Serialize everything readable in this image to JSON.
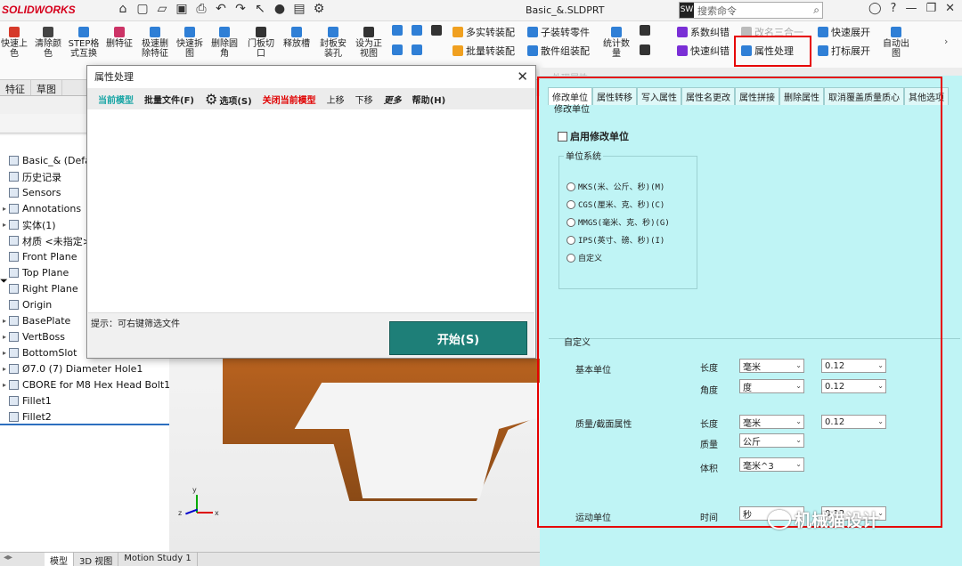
{
  "app": {
    "logo": "SOLIDWORKS",
    "doc_title": "Basic_&.SLDPRT",
    "search_placeholder": "搜索命令"
  },
  "ribbon": {
    "big_buttons": [
      {
        "label": "快速上\n色",
        "color": "#d63a2a"
      },
      {
        "label": "清除颜\n色",
        "color": "#444444"
      },
      {
        "label": "STEP格\n式互换",
        "color": "#2f7fd6"
      },
      {
        "label": "删特征",
        "color": "#cc3366"
      },
      {
        "label": "极速删\n除特征",
        "color": "#2f7fd6"
      },
      {
        "label": "快速拆\n图",
        "color": "#2f7fd6"
      },
      {
        "label": "删除圆\n角",
        "color": "#2f7fd6"
      },
      {
        "label": "门板切\n口",
        "color": "#333333"
      },
      {
        "label": "释放槽",
        "color": "#2f7fd6"
      },
      {
        "label": "封板安\n装孔",
        "color": "#2f7fd6"
      },
      {
        "label": "设为正\n视图",
        "color": "#333333"
      }
    ],
    "small_buttons": [
      {
        "label": "多实转装配",
        "color": "#f0a020"
      },
      {
        "label": "子装转零件",
        "color": "#2f7fd6"
      },
      {
        "label": "批量转装配",
        "color": "#f0a020"
      },
      {
        "label": "散件组装配",
        "color": "#2f7fd6"
      },
      {
        "label": "统计数\n量",
        "color": "#2f7fd6"
      },
      {
        "label": "系数纠错",
        "color": "#7a2fd6"
      },
      {
        "label": "改名三合一",
        "color": "#bbbbbb"
      },
      {
        "label": "快速展开",
        "color": "#2f7fd6"
      },
      {
        "label": "快速纠错",
        "color": "#7a2fd6"
      },
      {
        "label": "属性处理",
        "color": "#2f7fd6"
      },
      {
        "label": "打标展开",
        "color": "#2f7fd6"
      },
      {
        "label": "自动出\n图",
        "color": "#2f7fd6"
      }
    ]
  },
  "left_tabs": [
    "特征",
    "草图"
  ],
  "tree": [
    {
      "label": "Basic_& (Default)",
      "exp": ""
    },
    {
      "label": "历史记录",
      "exp": ""
    },
    {
      "label": "Sensors",
      "exp": ""
    },
    {
      "label": "Annotations",
      "exp": "▸"
    },
    {
      "label": "实体(1)",
      "exp": "▸"
    },
    {
      "label": "材质 <未指定>",
      "exp": ""
    },
    {
      "label": "Front Plane",
      "exp": ""
    },
    {
      "label": "Top Plane",
      "exp": ""
    },
    {
      "label": "Right Plane",
      "exp": ""
    },
    {
      "label": "Origin",
      "exp": ""
    },
    {
      "label": "BasePlate",
      "exp": "▸"
    },
    {
      "label": "VertBoss",
      "exp": "▸"
    },
    {
      "label": "BottomSlot",
      "exp": "▸"
    },
    {
      "label": "Ø7.0 (7) Diameter Hole1",
      "exp": "▸"
    },
    {
      "label": "CBORE for M8 Hex Head Bolt1",
      "exp": "▸"
    },
    {
      "label": "Fillet1",
      "exp": ""
    },
    {
      "label": "Fillet2",
      "exp": ""
    }
  ],
  "bottom_tabs": [
    "模型",
    "3D 视图",
    "Motion Study 1"
  ],
  "axes": {
    "x": "x",
    "y": "y",
    "z": "z"
  },
  "dialog": {
    "title": "属性处理",
    "menu": {
      "current_model": "当前模型",
      "batch_files": "批量文件(F)",
      "options": "选项(S)",
      "close_model": "关闭当前模型",
      "move_up": "上移",
      "move_down": "下移",
      "more": "更多",
      "help": "帮助(H)"
    },
    "hint": "提示：可右键筛选文件",
    "start": "开始(S)"
  },
  "panel": {
    "ghost_title": "处理属性",
    "tabs": [
      "修改单位",
      "属性转移",
      "写入属性",
      "属性名更改",
      "属性拼接",
      "删除属性",
      "取消覆盖质量质心",
      "其他选项"
    ],
    "sub_label": "修改单位",
    "enable_label": "启用修改单位",
    "unit_system_title": "单位系统",
    "unit_options": [
      "MKS(米、公斤、秒)(M)",
      "CGS(厘米、克、秒)(C)",
      "MMGS(毫米、克、秒)(G)",
      "IPS(英寸、磅、秒)(I)",
      "自定义"
    ],
    "custom_title": "自定义",
    "basic_units": "基本单位",
    "mass_props": "质量/截面属性",
    "motion_units": "运动单位",
    "length": "长度",
    "angle": "角度",
    "mass": "质量",
    "volume": "体积",
    "time": "时间",
    "length_val": "毫米",
    "length_dec": "0.12",
    "angle_val": "度",
    "angle_dec": "0.12",
    "mp_length_val": "毫米",
    "mp_length_dec": "0.12",
    "mass_val": "公斤",
    "volume_val": "毫米^3",
    "time_val": "秒",
    "time_dec": "0.12"
  },
  "watermark": "机械猫设计",
  "colors": {
    "panel_bg": "#bff4f5",
    "highlight": "#e60000",
    "start_btn": "#1e7f78",
    "menu_teal": "#1aa6a6",
    "menu_red": "#e00000"
  }
}
